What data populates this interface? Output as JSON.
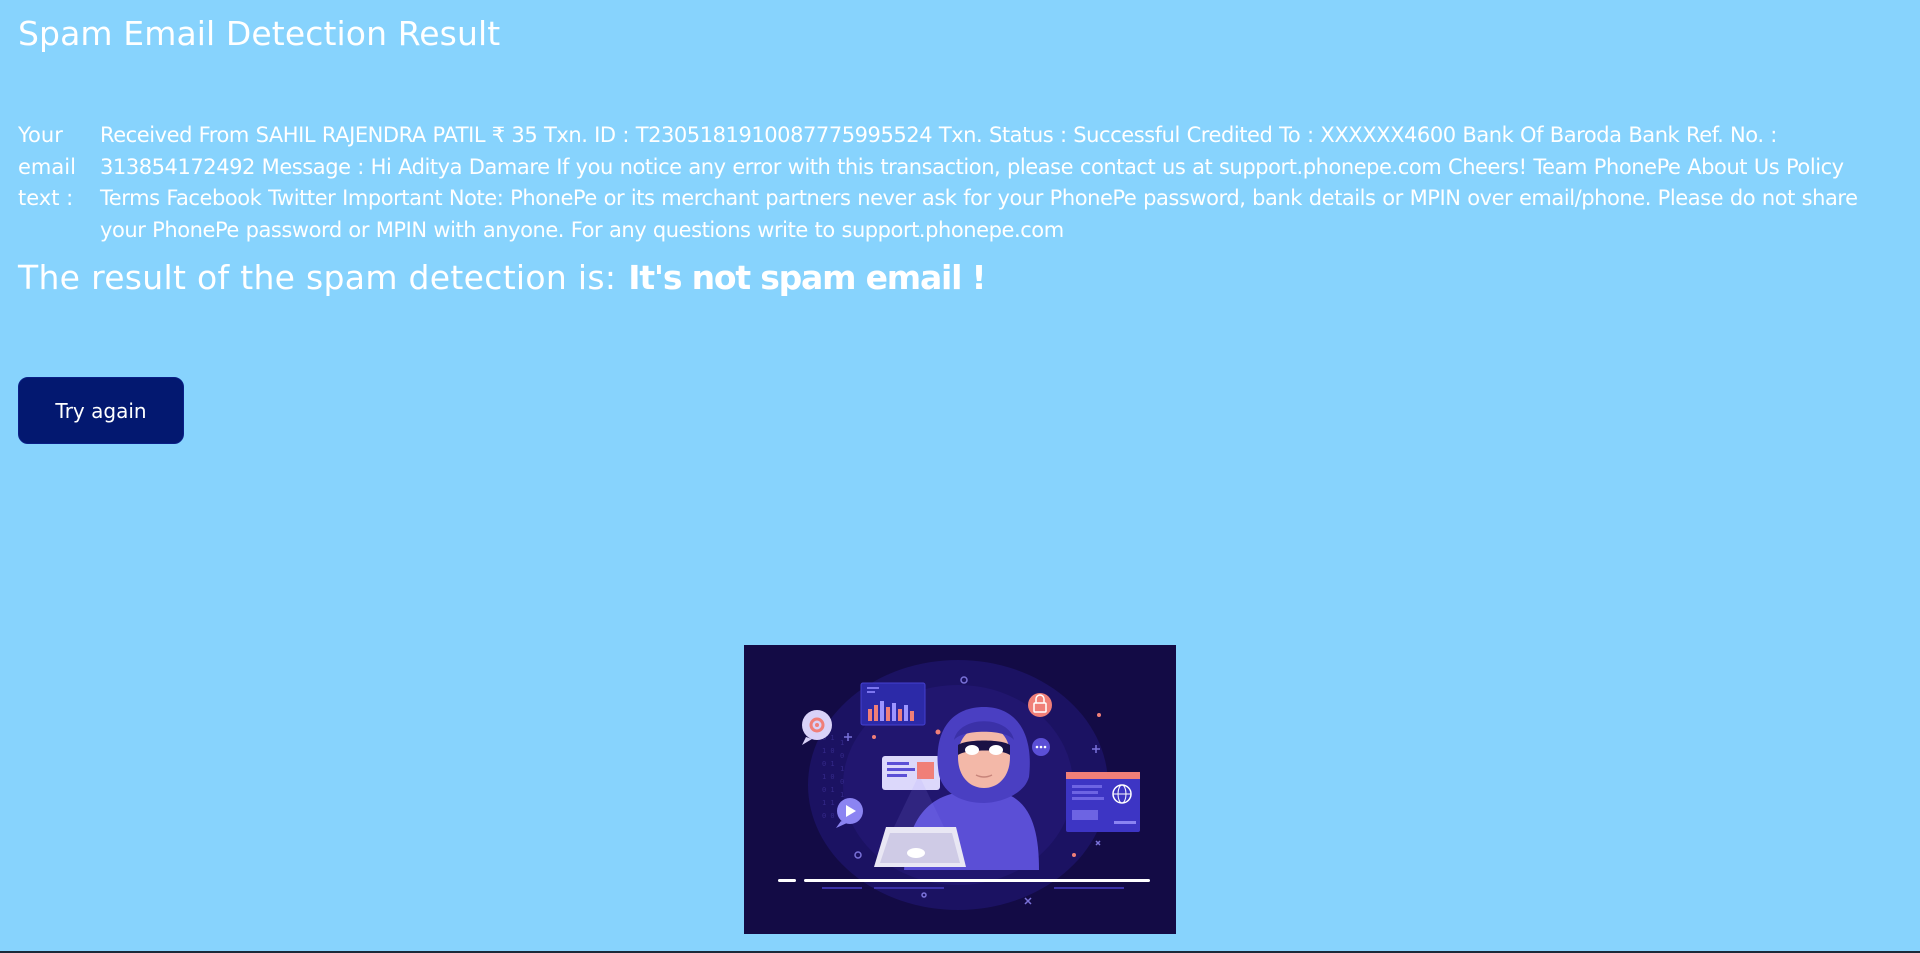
{
  "page": {
    "title": "Spam Email Detection Result"
  },
  "email": {
    "label": "Your email text :",
    "text": "Received From SAHIL RAJENDRA PATIL ₹ 35 Txn. ID : T2305181910087775995524 Txn. Status : Successful Credited To : XXXXXX4600 Bank Of Baroda Bank Ref. No. : 313854172492 Message : Hi Aditya Damare If you notice any error with this transaction, please contact us at support.phonepe.com Cheers! Team PhonePe About Us Policy Terms Facebook Twitter Important Note: PhonePe or its merchant partners never ask for your PhonePe password, bank details or MPIN over email/phone. Please do not share your PhonePe password or MPIN with anyone. For any questions write to support.phonepe.com"
  },
  "result": {
    "prefix": "The result of the spam detection is:",
    "value": "It's not spam email !"
  },
  "actions": {
    "try_again_label": "Try again"
  },
  "illustration": {
    "subject": "hooded hacker at laptop illustration",
    "icons": [
      "gear-icon",
      "play-icon",
      "chat-icon",
      "lock-icon",
      "globe-icon",
      "bar-chart-icon"
    ]
  },
  "colors": {
    "background": "#87d3fd",
    "text": "#ffffff",
    "button": "#031870",
    "illustration_background": "#130b45",
    "accent_purple": "#5b4fd6",
    "accent_coral": "#f07f78"
  }
}
